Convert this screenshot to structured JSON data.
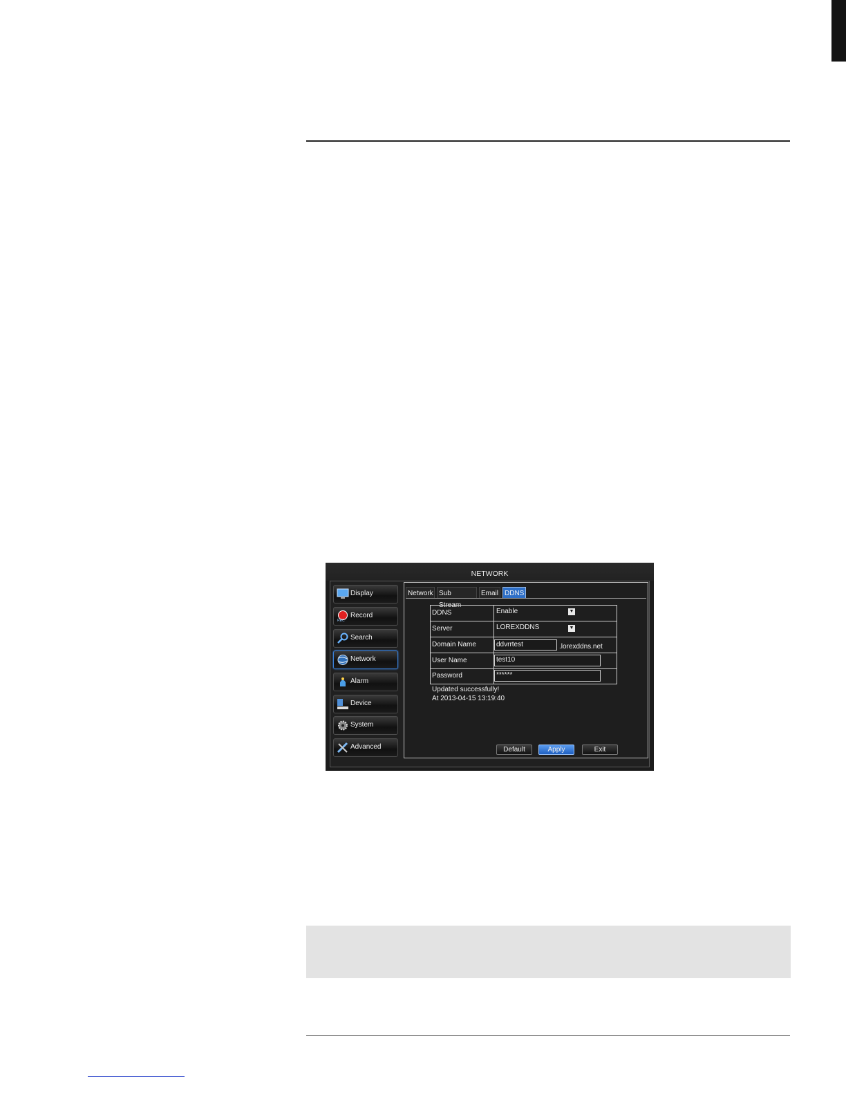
{
  "dvr": {
    "title": "NETWORK",
    "menu": [
      {
        "label": "Display",
        "icon": "monitor-icon"
      },
      {
        "label": "Record",
        "icon": "record-icon"
      },
      {
        "label": "Search",
        "icon": "search-icon"
      },
      {
        "label": "Network",
        "icon": "globe-icon"
      },
      {
        "label": "Alarm",
        "icon": "alarm-icon"
      },
      {
        "label": "Device",
        "icon": "device-icon"
      },
      {
        "label": "System",
        "icon": "gear-icon"
      },
      {
        "label": "Advanced",
        "icon": "tools-icon"
      }
    ],
    "active_menu": "Network",
    "tabs": [
      "Network",
      "Sub Stream",
      "Email",
      "DDNS"
    ],
    "active_tab": "DDNS",
    "form": {
      "ddns_label": "DDNS",
      "ddns_value": "Enable",
      "server_label": "Server",
      "server_value": "LOREXDDNS",
      "domain_label": "Domain Name",
      "domain_value": "ddvrrtest",
      "domain_suffix": ".lorexddns.net",
      "user_label": "User Name",
      "user_value": "test10",
      "password_label": "Password",
      "password_value": "******"
    },
    "status": {
      "line1": "Updated successfully!",
      "line2": "At 2013-04-15 13:19:40"
    },
    "buttons": {
      "default": "Default",
      "apply": "Apply",
      "exit": "Exit"
    }
  }
}
